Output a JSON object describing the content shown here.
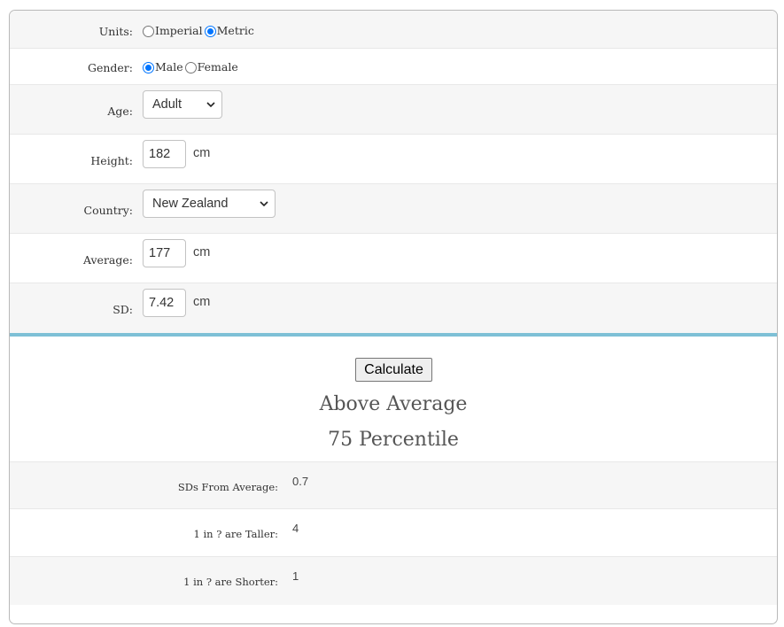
{
  "form": {
    "units": {
      "label": "Units:",
      "options": [
        "Imperial",
        "Metric"
      ],
      "selected": "Metric"
    },
    "gender": {
      "label": "Gender:",
      "options": [
        "Male",
        "Female"
      ],
      "selected": "Male"
    },
    "age": {
      "label": "Age:",
      "value": "Adult"
    },
    "height": {
      "label": "Height:",
      "value": "182",
      "unit": "cm"
    },
    "country": {
      "label": "Country:",
      "value": "New Zealand"
    },
    "average": {
      "label": "Average:",
      "value": "177",
      "unit": "cm"
    },
    "sd": {
      "label": "SD:",
      "value": "7.42",
      "unit": "cm"
    }
  },
  "calculate_label": "Calculate",
  "results": {
    "category": "Above Average",
    "percentile": "75 Percentile",
    "rows": [
      {
        "label": "SDs From Average:",
        "value": "0.7"
      },
      {
        "label": "1 in ? are Taller:",
        "value": "4"
      },
      {
        "label": "1 in ? are Shorter:",
        "value": "1"
      }
    ]
  },
  "colors": {
    "divider": "#7ec0d6",
    "radio_accent": "#0075ff",
    "alt_row": "#f6f6f6"
  }
}
